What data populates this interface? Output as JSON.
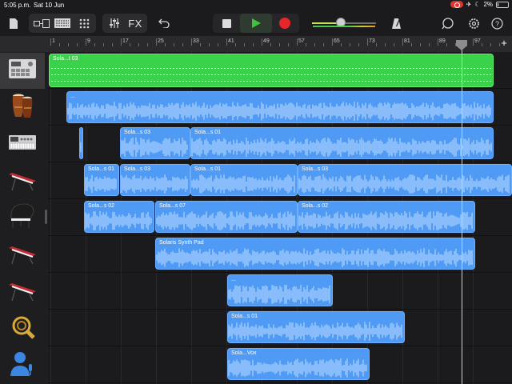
{
  "status_bar": {
    "time": "5:05 p.m.",
    "date": "Sat 10 Jun",
    "battery": "2%"
  },
  "toolbar": {
    "fx_label": "FX",
    "icons": [
      "my-songs-icon",
      "browser-icon",
      "tracks-view-icon",
      "grid-icon",
      "mixer-icon",
      "fx-icon",
      "undo-icon",
      "stop-icon",
      "play-icon",
      "record-icon",
      "master-volume-icon",
      "metronome-icon",
      "loop-browser-icon",
      "settings-icon",
      "help-icon"
    ],
    "master_volume": 0.45
  },
  "ruler": {
    "bars": [
      "1",
      "9",
      "17",
      "25",
      "33",
      "41",
      "49",
      "57",
      "65",
      "73",
      "81",
      "89",
      "97"
    ],
    "add_label": "+"
  },
  "tracks": [
    {
      "name": "beat-sequencer-track",
      "icon": "drum-machine-icon",
      "selected": true,
      "regions": [
        {
          "label": "Sola...t 03",
          "color": "green"
        }
      ]
    },
    {
      "name": "percussion-track",
      "icon": "congas-icon",
      "regions": [
        {
          "label": "...",
          "color": "blue"
        }
      ]
    },
    {
      "name": "synth-track",
      "icon": "synth-module-icon",
      "regions": [
        {
          "label": "",
          "color": "blue"
        },
        {
          "label": "Sola...s 03",
          "color": "blue"
        },
        {
          "label": "Sola...s 01",
          "color": "blue"
        }
      ]
    },
    {
      "name": "keyboard-track-1",
      "icon": "red-keyboard-icon",
      "regions": [
        {
          "label": "Sola...s 01",
          "color": "blue"
        },
        {
          "label": "Sola...s 03",
          "color": "blue"
        },
        {
          "label": "Sola...s 01",
          "color": "blue"
        },
        {
          "label": "Sola...s 03",
          "color": "blue"
        }
      ]
    },
    {
      "name": "piano-track",
      "icon": "grand-piano-icon",
      "regions": [
        {
          "label": "Sola...s 02",
          "color": "blue"
        },
        {
          "label": "Sola...s 07",
          "color": "blue"
        },
        {
          "label": "Sola...s 02",
          "color": "blue"
        }
      ]
    },
    {
      "name": "keyboard-track-2",
      "icon": "red-keyboard-icon",
      "regions": [
        {
          "label": "Solaris Synth Pad",
          "color": "blue"
        }
      ]
    },
    {
      "name": "keyboard-track-3",
      "icon": "red-keyboard-icon",
      "regions": [
        {
          "label": "...",
          "color": "blue"
        }
      ]
    },
    {
      "name": "horn-track",
      "icon": "french-horn-icon",
      "regions": [
        {
          "label": "Sola...s 01",
          "color": "blue"
        }
      ]
    },
    {
      "name": "vocal-track",
      "icon": "vocalist-icon",
      "regions": [
        {
          "label": "Sola...Vox",
          "color": "blue"
        }
      ]
    }
  ],
  "colors": {
    "region_blue": "#4f9af5",
    "region_green": "#3ad24a",
    "record_red": "#e9252c",
    "play_green": "#3ec43a"
  }
}
